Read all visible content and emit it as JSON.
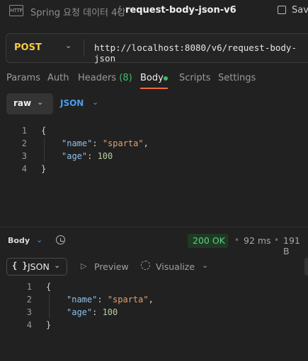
{
  "header": {
    "http_icon": "HTTP",
    "collection": "Spring 요청 데이터 4강",
    "separator": "/",
    "request_name": "request-body-json-v6",
    "save_label": "Save",
    "icons": [
      "http-file-icon",
      "save-icon"
    ]
  },
  "url_bar": {
    "method": "POST",
    "url": "http://localhost:8080/v6/request-body-json",
    "method_color": "#f6ca41"
  },
  "request_tabs": {
    "params": "Params",
    "auth": "Auth",
    "headers": "Headers",
    "headers_count": "(8)",
    "body": "Body",
    "scripts": "Scripts",
    "settings": "Settings",
    "active": "Body",
    "active_indicator_color": "#ef6b3a",
    "dot_color": "#3fbf6a"
  },
  "body_mode": {
    "mode": "raw",
    "language": "JSON"
  },
  "request_editor": {
    "line_numbers": [
      "1",
      "2",
      "3",
      "4"
    ],
    "open_brace": "{",
    "close_brace": "}",
    "key_name": "\"name\"",
    "val_name": "\"sparta\"",
    "key_age": "\"age\"",
    "val_age": "100",
    "colon": ": ",
    "comma": ","
  },
  "response": {
    "body_label": "Body",
    "status": "200 OK",
    "time": "92 ms",
    "size": "191 B",
    "dot": "•",
    "status_color": "#5fd07f",
    "format_braces": "{ }",
    "format": "JSON",
    "preview": "Preview",
    "visualize": "Visualize",
    "icons": [
      "history-icon",
      "play-icon",
      "visualize-icon"
    ]
  },
  "response_editor": {
    "line_numbers": [
      "1",
      "2",
      "3",
      "4"
    ],
    "open_brace": "{",
    "close_brace": "}",
    "key_name": "\"name\"",
    "val_name": "\"sparta\"",
    "key_age": "\"age\"",
    "val_age": "100",
    "colon": ": ",
    "comma": ","
  }
}
